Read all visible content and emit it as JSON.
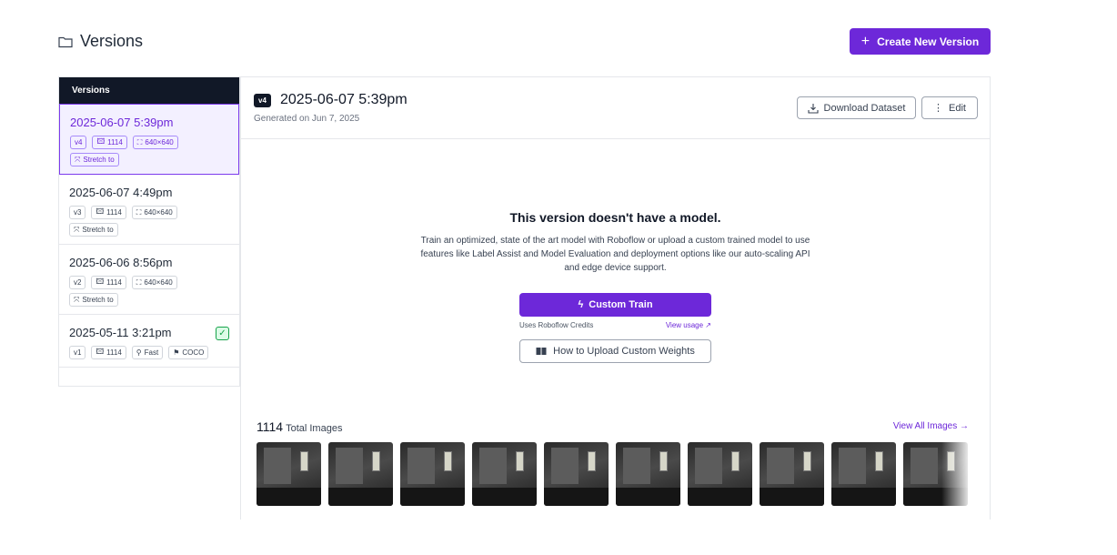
{
  "header": {
    "title": "Versions",
    "title_icon": "folder-icon",
    "create_label": "Create New Version"
  },
  "sidebar": {
    "heading": "Versions",
    "items": [
      {
        "title": "2025-06-07 5:39pm",
        "active": true,
        "tags": [
          "v4",
          "1114",
          "640×640",
          "Stretch to"
        ]
      },
      {
        "title": "2025-06-07 4:49pm",
        "active": false,
        "tags": [
          "v3",
          "1114",
          "640×640",
          "Stretch to"
        ]
      },
      {
        "title": "2025-06-06 8:56pm",
        "active": false,
        "tags": [
          "v2",
          "1114",
          "640×640",
          "Stretch to"
        ]
      },
      {
        "title": "2025-05-11 3:21pm",
        "active": false,
        "has_model": true,
        "tags": [
          "v1",
          "1114",
          "Fast",
          "COCO"
        ]
      }
    ]
  },
  "main": {
    "version_badge": "v4",
    "title": "2025-06-07 5:39pm",
    "subtitle": "Generated on Jun 7, 2025",
    "download_label": "Download Dataset",
    "edit_label": "Edit",
    "empty": {
      "title": "This version doesn't have a model.",
      "description": "Train an optimized, state of the art model with Roboflow or upload a custom trained model to use features like Label Assist and Model Evaluation and deployment options like our auto-scaling API and edge device support.",
      "train_label": "Custom Train",
      "credits_label": "Uses Roboflow Credits",
      "usage_label": "View usage ↗",
      "weights_label": "How to Upload Custom Weights"
    },
    "images": {
      "count": "1114",
      "count_label": "Total Images",
      "view_all_label": "View All Images →",
      "thumbnail_count": 10
    }
  },
  "colors": {
    "accent": "#6d28d9",
    "dark_header": "#111827",
    "success": "#16a34a"
  }
}
